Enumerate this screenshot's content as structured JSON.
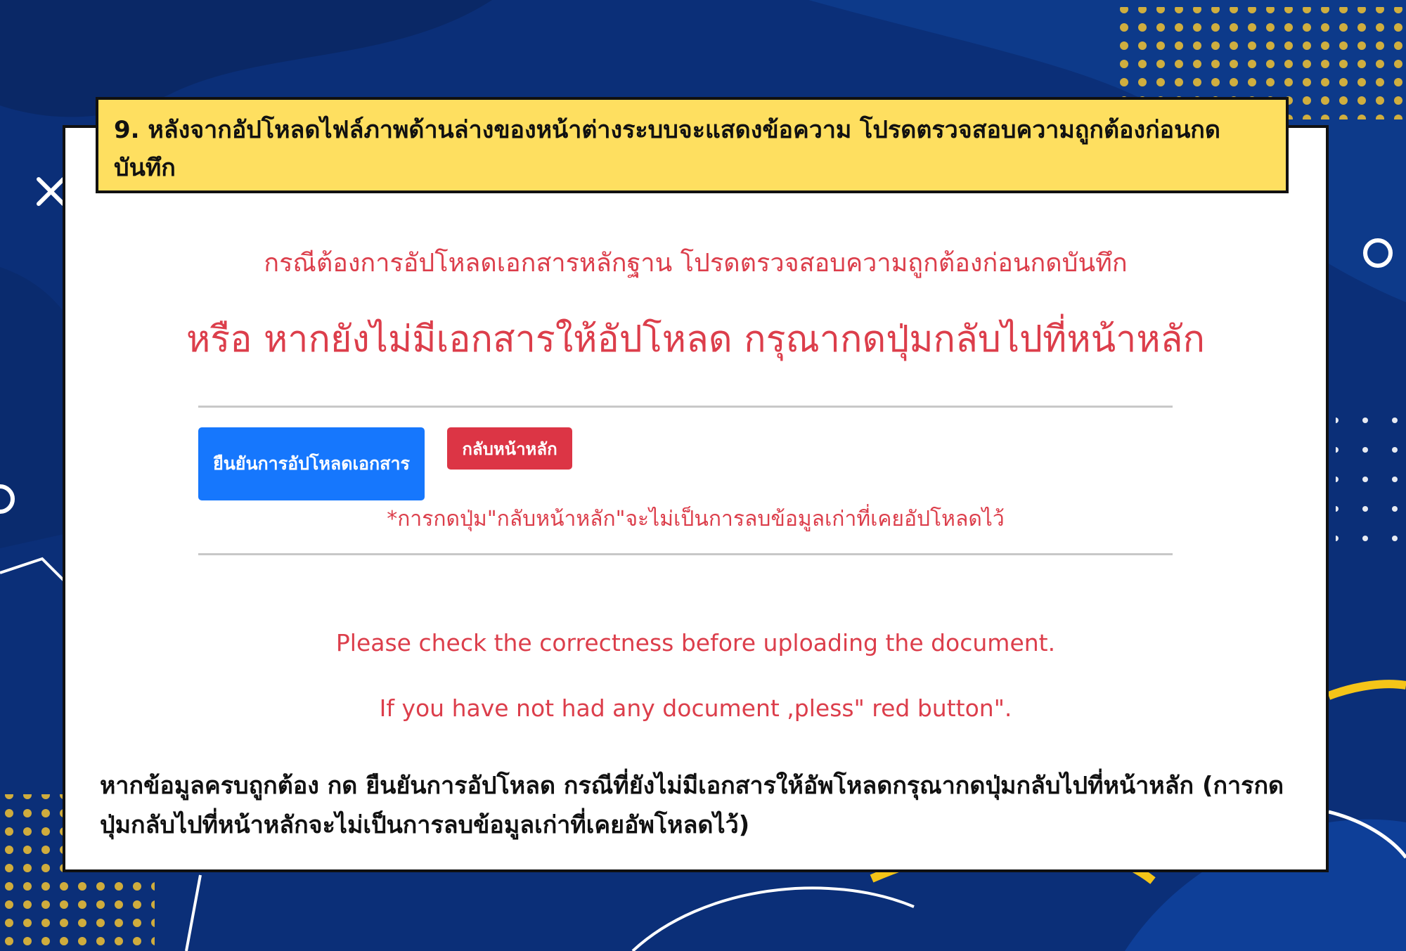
{
  "banner": {
    "text": "9. หลังจากอัปโหลดไฟล์ภาพด้านล่างของหน้าต่างระบบจะแสดงข้อความ โปรดตรวจสอบความถูกต้องก่อนกดบันทึก"
  },
  "dialog": {
    "subtitle": "กรณีต้องการอัปโหลดเอกสารหลักฐาน โปรดตรวจสอบความถูกต้องก่อนกดบันทึก",
    "headline": "หรือ หากยังไม่มีเอกสารให้อัปโหลด กรุณากดปุ่มกลับไปที่หน้าหลัก",
    "confirm_button": "ยืนยันการอัปโหลดเอกสาร",
    "back_button": "กลับหน้าหลัก",
    "note": "*การกดปุ่ม\"กลับหน้าหลัก\"จะไม่เป็นการลบข้อมูลเก่าที่เคยอัปโหลดไว้",
    "english_line1": "Please check the correctness before uploading the document.",
    "english_line2": "If you have not had any document ,pless\" red button\"."
  },
  "footer": {
    "text": " หากข้อมูลครบถูกต้อง กด ยืนยันการอัปโหลด กรณีที่ยังไม่มีเอกสารให้อัพโหลดกรุณากดปุ่มกลับไปที่หน้าหลัก (การกดปุ่มกลับไปที่หน้าหลักจะไม่เป็นการลบข้อมูลเก่าที่เคยอัพโหลดไว้)"
  },
  "colors": {
    "background": "#0b2f78",
    "banner": "#fedf60",
    "accent_red": "#dc3545",
    "accent_blue": "#1677fd",
    "decor_yellow": "#f5c518"
  }
}
